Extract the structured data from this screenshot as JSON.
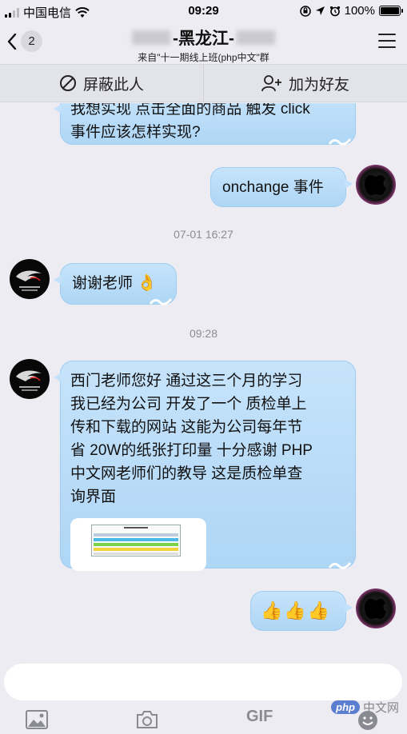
{
  "status_bar": {
    "carrier": "中国电信",
    "time": "09:29",
    "battery": "100%",
    "battery_level": 1.0
  },
  "header": {
    "back_count": "2",
    "title_suffix": "-黑龙江-",
    "subtitle": "来自\"十一期线上班(php中文\"群"
  },
  "actions": {
    "block_label": "屏蔽此人",
    "add_friend_label": "加为好友"
  },
  "messages": [
    {
      "side": "left",
      "text_lines": [
        "我想实现 点击全面的商品 触发 click",
        "事件应该怎样实现?"
      ]
    },
    {
      "side": "right",
      "text": "onchange 事件"
    },
    {
      "type": "timestamp",
      "text": "07-01 16:27"
    },
    {
      "side": "left",
      "text": "谢谢老师",
      "emoji": "👌"
    },
    {
      "type": "timestamp",
      "text": "09:28"
    },
    {
      "side": "left",
      "text_lines": [
        "西门老师您好 通过这三个月的学习",
        "我已经为公司 开发了一个 质检单上",
        "传和下载的网站 这能为公司每年节",
        "省 20W的纸张打印量 十分感谢 PHP",
        "中文网老师们的教导 这是质检单查",
        "询界面"
      ]
    },
    {
      "side": "right",
      "emoji": "👍👍👍"
    }
  ],
  "toolbar": {
    "gif_label": "GIF"
  },
  "watermark": {
    "badge": "php",
    "text": "中文网"
  },
  "colors": {
    "bubble": "#b8dbf7",
    "background": "#ececf2",
    "timestamp": "#8c8c92"
  }
}
